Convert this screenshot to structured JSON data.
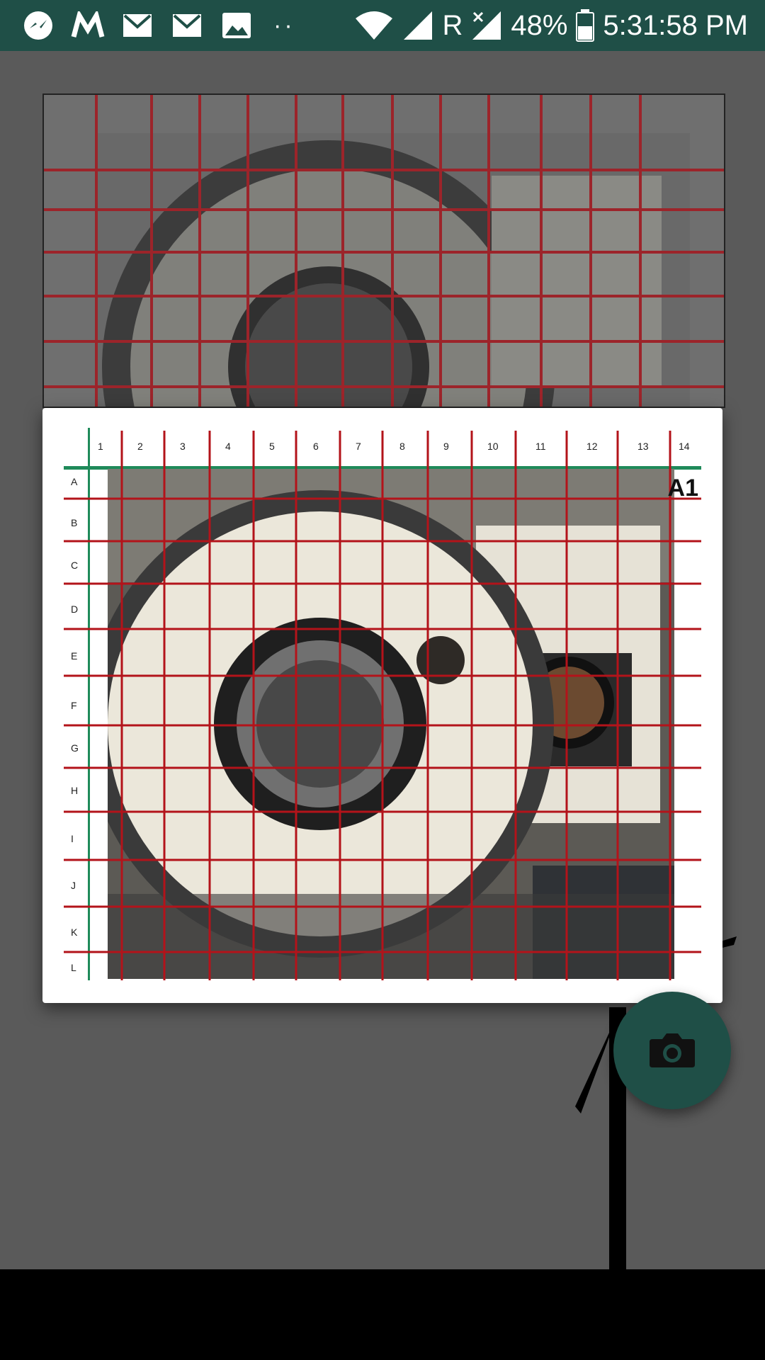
{
  "status_bar": {
    "time": "5:31:58 PM",
    "battery": "48%",
    "network_label": "R",
    "icons": [
      "messenger-icon",
      "maps-icon",
      "gmail-icon",
      "gmail-icon",
      "gallery-icon",
      "more-dots-icon",
      "wifi-icon",
      "signal-icon",
      "battery-icon"
    ]
  },
  "grid": {
    "columns": [
      "1",
      "2",
      "3",
      "4",
      "5",
      "6",
      "7",
      "8",
      "9",
      "10",
      "11",
      "12",
      "13",
      "14"
    ],
    "rows": [
      "A",
      "B",
      "C",
      "D",
      "E",
      "F",
      "G",
      "H",
      "I",
      "J",
      "K",
      "L"
    ]
  },
  "dialog": {
    "cell_tag": "A1"
  },
  "fab": {
    "icon": "camera-icon",
    "color": "#1f4f47"
  },
  "colors": {
    "status_bar": "#1f4f47",
    "grid_lines": "#b3131a",
    "grid_header": "#1f8a5a",
    "background": "#5a5a5a"
  }
}
